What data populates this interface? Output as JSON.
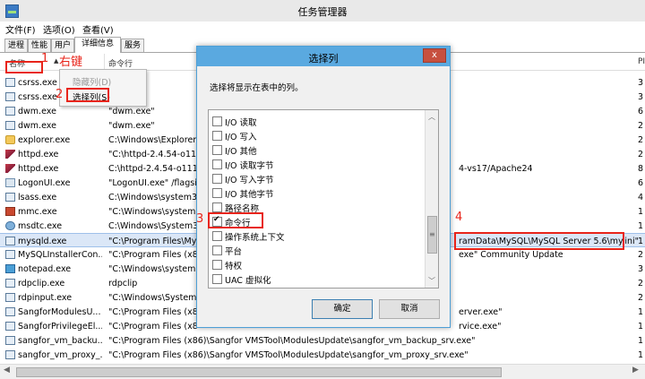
{
  "window": {
    "title": "任务管理器"
  },
  "menu": [
    "文件(F)",
    "选项(O)",
    "查看(V)"
  ],
  "tabs": [
    "进程",
    "性能",
    "用户",
    "详细信息",
    "服务"
  ],
  "active_tab": 3,
  "columns": {
    "name": "名称",
    "command": "命令行",
    "pid": "PI"
  },
  "rows": [
    {
      "icon": "window-icon",
      "name": "csrss.exe",
      "cmd": "",
      "pid": "3"
    },
    {
      "icon": "window-icon",
      "name": "csrss.exe",
      "cmd": "",
      "pid": "3"
    },
    {
      "icon": "window-icon",
      "name": "dwm.exe",
      "cmd": "\"dwm.exe\"",
      "pid": "6"
    },
    {
      "icon": "window-icon",
      "name": "dwm.exe",
      "cmd": "\"dwm.exe\"",
      "pid": "2"
    },
    {
      "icon": "explorer-icon",
      "name": "explorer.exe",
      "cmd": "C:\\Windows\\Explorer.",
      "pid": "2"
    },
    {
      "icon": "apache-feather-icon",
      "name": "httpd.exe",
      "cmd": "\"C:\\httpd-2.4.54-o111",
      "pid": "2"
    },
    {
      "icon": "apache-feather-icon",
      "name": "httpd.exe",
      "cmd": "C:\\httpd-2.4.54-o111p",
      "cmd_tail": "4-vs17/Apache24",
      "pid": "8"
    },
    {
      "icon": "logon-icon",
      "name": "LogonUI.exe",
      "cmd": "\"LogonUI.exe\" /flagsi",
      "pid": "6"
    },
    {
      "icon": "window-icon",
      "name": "lsass.exe",
      "cmd": "C:\\Windows\\system32",
      "pid": "4"
    },
    {
      "icon": "mmc-icon",
      "name": "mmc.exe",
      "cmd": "\"C:\\Windows\\system3",
      "pid": "1"
    },
    {
      "icon": "gear-icon",
      "name": "msdtc.exe",
      "cmd": "C:\\Windows\\System32",
      "pid": "1"
    },
    {
      "icon": "window-icon",
      "name": "mysqld.exe",
      "cmd": "\"C:\\Program Files\\My",
      "cmd_tail": "ramData\\MySQL\\MySQL Server 5.6\\my.ini\"",
      "pid": "1"
    },
    {
      "icon": "window-icon",
      "name": "MySQLInstallerCon...",
      "cmd": "\"C:\\Program Files (x8",
      "cmd_tail": "exe\" Community Update",
      "pid": "2"
    },
    {
      "icon": "notepad-icon",
      "name": "notepad.exe",
      "cmd": "\"C:\\Windows\\system3",
      "pid": "3"
    },
    {
      "icon": "window-icon",
      "name": "rdpclip.exe",
      "cmd": "rdpclip",
      "pid": "2"
    },
    {
      "icon": "window-icon",
      "name": "rdpinput.exe",
      "cmd": "\"C:\\Windows\\System3",
      "pid": "2"
    },
    {
      "icon": "window-icon",
      "name": "SangforModulesU...",
      "cmd": "\"C:\\Program Files (x8",
      "cmd_tail": "erver.exe\"",
      "pid": "1"
    },
    {
      "icon": "window-icon",
      "name": "SangforPrivilegeEl...",
      "cmd": "\"C:\\Program Files (x8",
      "cmd_tail": "rvice.exe\"",
      "pid": "1"
    },
    {
      "icon": "window-icon",
      "name": "sangfor_vm_backu...",
      "cmd": "\"C:\\Program Files (x86)\\Sangfor VMSTool\\ModulesUpdate\\sangfor_vm_backup_srv.exe\"",
      "pid": "1"
    },
    {
      "icon": "window-icon",
      "name": "sangfor_vm_proxy_...",
      "cmd": "\"C:\\Program Files (x86)\\Sangfor VMSTool\\ModulesUpdate\\sangfor_vm_proxy_srv.exe\"",
      "pid": "1"
    }
  ],
  "selected_row": 11,
  "context_menu": {
    "hide_column": "隐藏列(D)",
    "select_columns": "选择列(S)"
  },
  "dialog": {
    "title": "选择列",
    "close": "x",
    "prompt": "选择将显示在表中的列。",
    "items": [
      {
        "label": "I/O 读取",
        "checked": false
      },
      {
        "label": "I/O 写入",
        "checked": false
      },
      {
        "label": "I/O 其他",
        "checked": false
      },
      {
        "label": "I/O 读取字节",
        "checked": false
      },
      {
        "label": "I/O 写入字节",
        "checked": false
      },
      {
        "label": "I/O 其他字节",
        "checked": false
      },
      {
        "label": "路径名称",
        "checked": false
      },
      {
        "label": "命令行",
        "checked": true
      },
      {
        "label": "操作系统上下文",
        "checked": false
      },
      {
        "label": "平台",
        "checked": false
      },
      {
        "label": "特权",
        "checked": false
      },
      {
        "label": "UAC 虚拟化",
        "checked": false
      }
    ],
    "ok": "确定",
    "cancel": "取消"
  },
  "annotations": {
    "n1": "1",
    "right_click": "右键",
    "n2": "2",
    "n3": "3",
    "n4": "4"
  },
  "colors": {
    "annotation": "#e8241a",
    "dialog_title": "#5aa9e0",
    "selection": "#dbe7f7"
  }
}
